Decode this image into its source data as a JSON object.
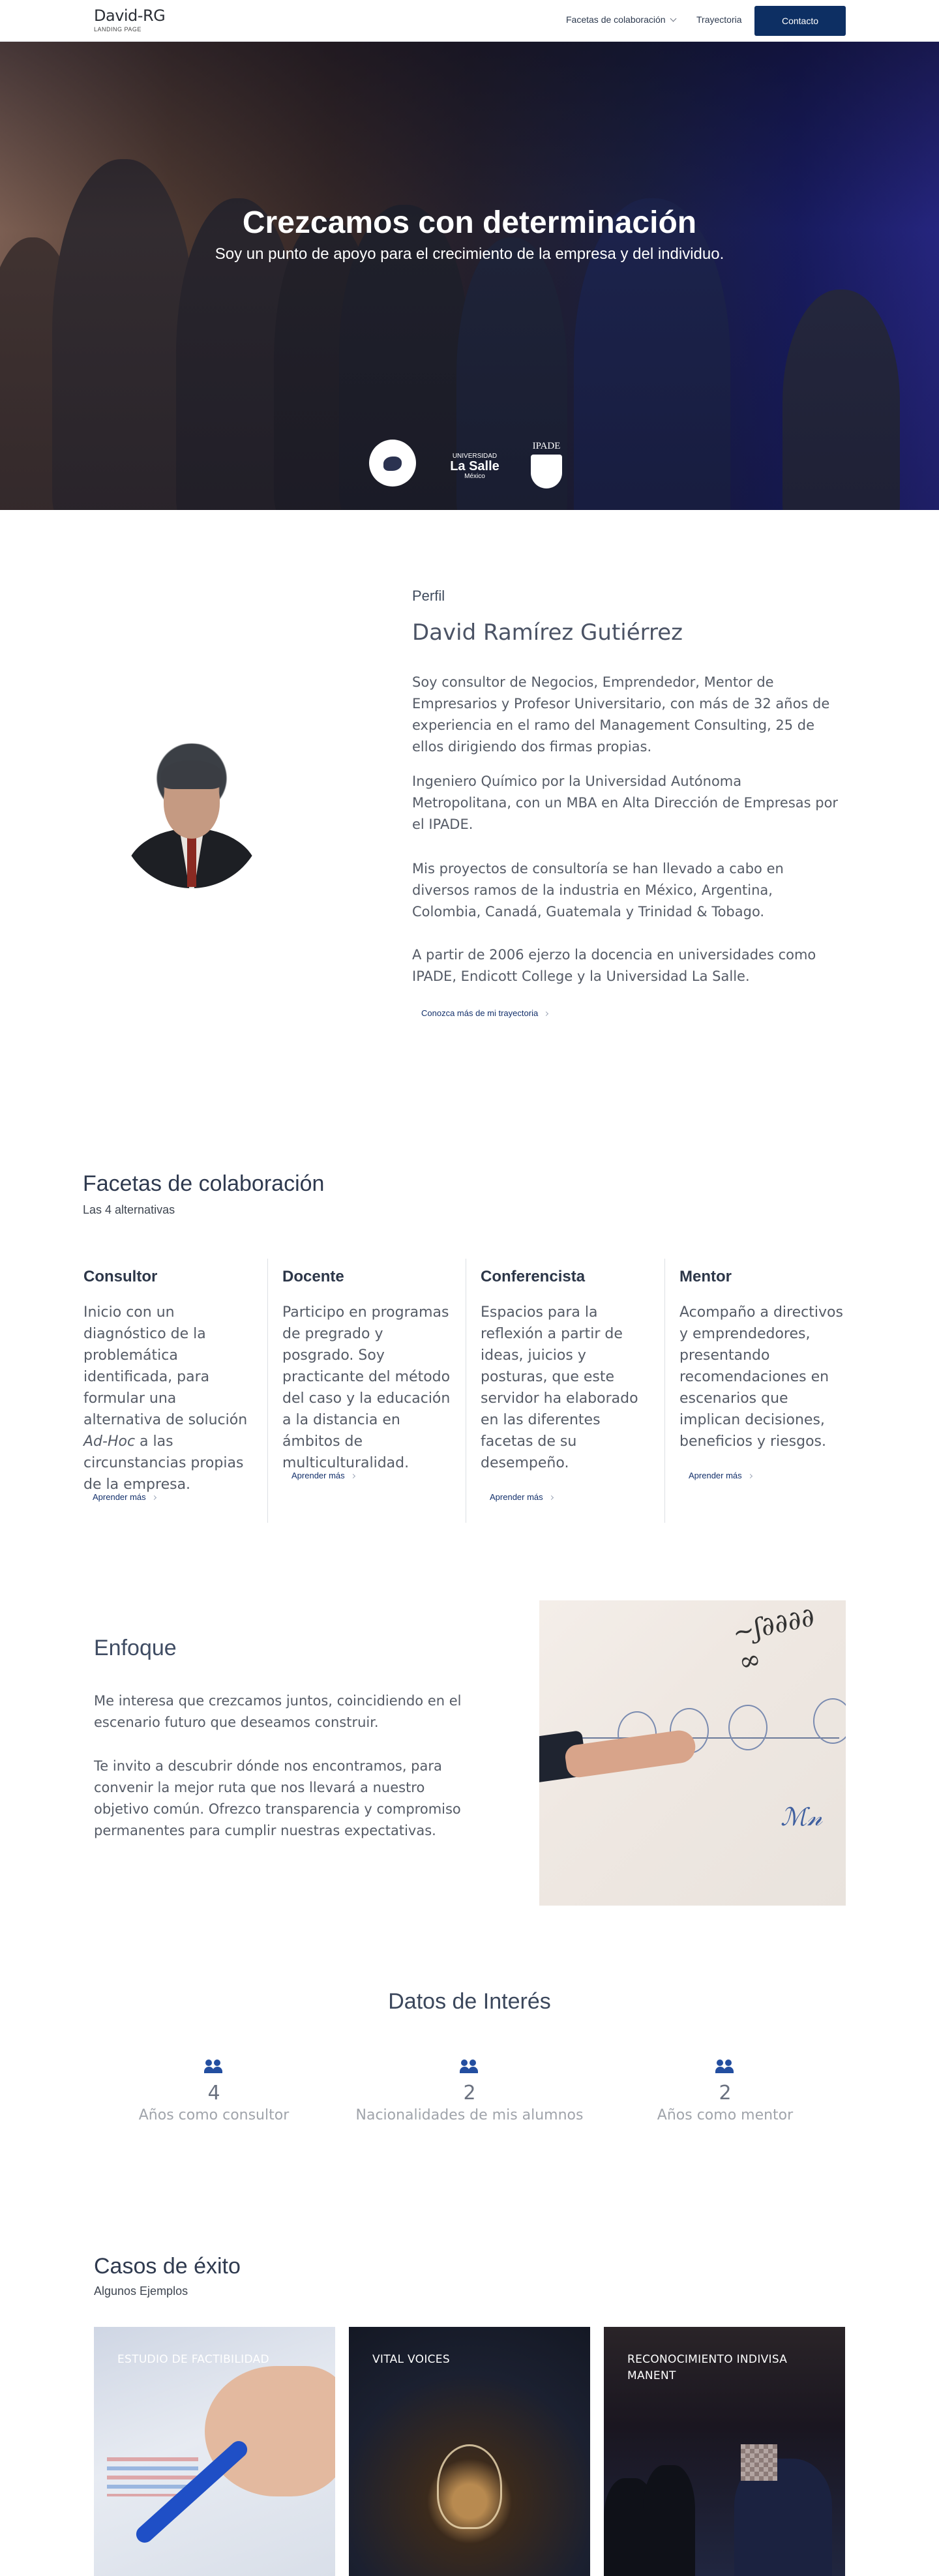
{
  "brand": {
    "title": "David-RG",
    "subtitle": "LANDING PAGE"
  },
  "nav": {
    "facetas": "Facetas de colaboración",
    "trayectoria": "Trayectoria",
    "contacto": "Contacto"
  },
  "hero": {
    "title": "Crezcamos con determinación",
    "subtitle": "Soy un punto de apoyo para el crecimiento de la empresa y del individuo.",
    "logos": {
      "lasalle_small": "UNIVERSIDAD",
      "lasalle": "La Salle",
      "lasalle_city": "México",
      "ipade": "IPADE"
    }
  },
  "perfil": {
    "kicker": "Perfil",
    "name": "David Ramírez Gutiérrez",
    "paragraphs": [
      "Soy consultor de Negocios, Emprendedor, Mentor de Empresarios y Profesor Universitario, con más de 32 años de experiencia en el ramo del Management Consulting, 25 de ellos dirigiendo dos firmas propias.",
      "Ingeniero Químico por la Universidad Autónoma Metropolitana, con un MBA en Alta Dirección de Empresas por el IPADE.",
      "Mis proyectos de consultoría se han llevado a cabo en diversos ramos de la industria en México, Argentina, Colombia, Canadá, Guatemala y Trinidad & Tobago.",
      "A partir de 2006 ejerzo la docencia en universidades como IPADE, Endicott College y la Universidad La Salle."
    ],
    "link": "Conozca más de mi trayectoria"
  },
  "facetas": {
    "title": "Facetas de colaboración",
    "subtitle": "Las 4 alternativas",
    "items": [
      {
        "title": "Consultor",
        "body_before": "Inicio con un diagnóstico de la problemática identificada, para formular una alternativa de solución ",
        "body_em": "Ad-Hoc",
        "body_after": " a las circunstancias propias de la empresa.",
        "link": "Aprender más"
      },
      {
        "title": "Docente",
        "body": "Participo en programas de pregrado y posgrado. Soy practicante del método del caso y la educación a la distancia en ámbitos de multiculturalidad.",
        "link": "Aprender más"
      },
      {
        "title": "Conferencista",
        "body": "Espacios para la reflexión a partir de ideas, juicios y posturas, que este servidor ha elaborado en las diferentes facetas de su desempeño.",
        "link": "Aprender más"
      },
      {
        "title": "Mentor",
        "body": "Acompaño a directivos y emprendedores, presentando recomendaciones en escenarios que implican decisiones, beneficios y riesgos.",
        "link": "Aprender más"
      }
    ]
  },
  "enfoque": {
    "title": "Enfoque",
    "paragraphs": [
      "Me interesa que crezcamos juntos, coincidiendo en el escenario futuro que deseamos construir.",
      "Te invito a descubrir dónde nos encontramos, para convenir la mejor ruta que nos llevará a nuestro objetivo común. Ofrezco transparencia y compromiso permanentes para cumplir nuestras expectativas."
    ]
  },
  "datos": {
    "title": "Datos de Interés",
    "stats": [
      {
        "value": "4",
        "label": "Años como consultor",
        "icon": "users-icon"
      },
      {
        "value": "2",
        "label": "Nacionalidades de mis alumnos",
        "icon": "users-icon"
      },
      {
        "value": "2",
        "label": "Años como mentor",
        "icon": "users-icon"
      }
    ]
  },
  "casos": {
    "title": "Casos de éxito",
    "subtitle": "Algunos Ejemplos",
    "cards": [
      {
        "title": "ESTUDIO DE FACTIBILIDAD"
      },
      {
        "title": "VITAL VOICES"
      },
      {
        "title": "RECONOCIMIENTO INDIVISA MANENT"
      }
    ]
  },
  "colors": {
    "primary": "#0d2f63",
    "icon": "#234ea0",
    "text": "#555b66"
  }
}
